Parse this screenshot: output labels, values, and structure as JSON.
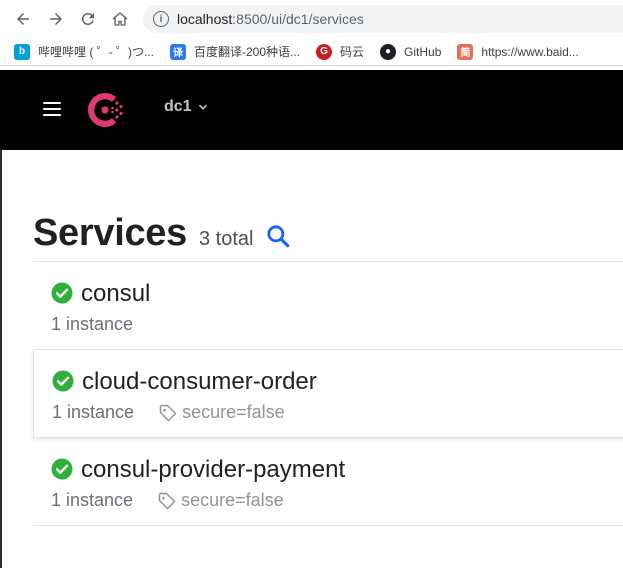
{
  "browser": {
    "url_host": "localhost",
    "url_rest": ":8500/ui/dc1/services",
    "bookmarks": [
      {
        "label": "哔哩哔哩 ( ゜- ゜)つ...",
        "icon": "bilibili-icon",
        "color": "#00a1d6",
        "glyph": "b"
      },
      {
        "label": "百度翻译-200种语...",
        "icon": "baidu-translate-icon",
        "color": "#2b7ce9",
        "glyph": "译"
      },
      {
        "label": "码云",
        "icon": "gitee-icon",
        "color": "#c71d23",
        "glyph": "G"
      },
      {
        "label": "GitHub",
        "icon": "github-icon",
        "color": "#1b1f23",
        "glyph": "●"
      },
      {
        "label": "https://www.baid...",
        "icon": "jianshu-icon",
        "color": "#ea6f5a",
        "glyph": "简"
      }
    ]
  },
  "header": {
    "datacenter": "dc1"
  },
  "main": {
    "title": "Services",
    "total": "3 total"
  },
  "services": [
    {
      "name": "consul",
      "instances": "1 instance",
      "tag": ""
    },
    {
      "name": "cloud-consumer-order",
      "instances": "1 instance",
      "tag": "secure=false"
    },
    {
      "name": "consul-provider-payment",
      "instances": "1 instance",
      "tag": "secure=false"
    }
  ],
  "colors": {
    "consul_brand": "#e03875",
    "passing_green": "#2eb039",
    "search_blue": "#1563ff"
  }
}
